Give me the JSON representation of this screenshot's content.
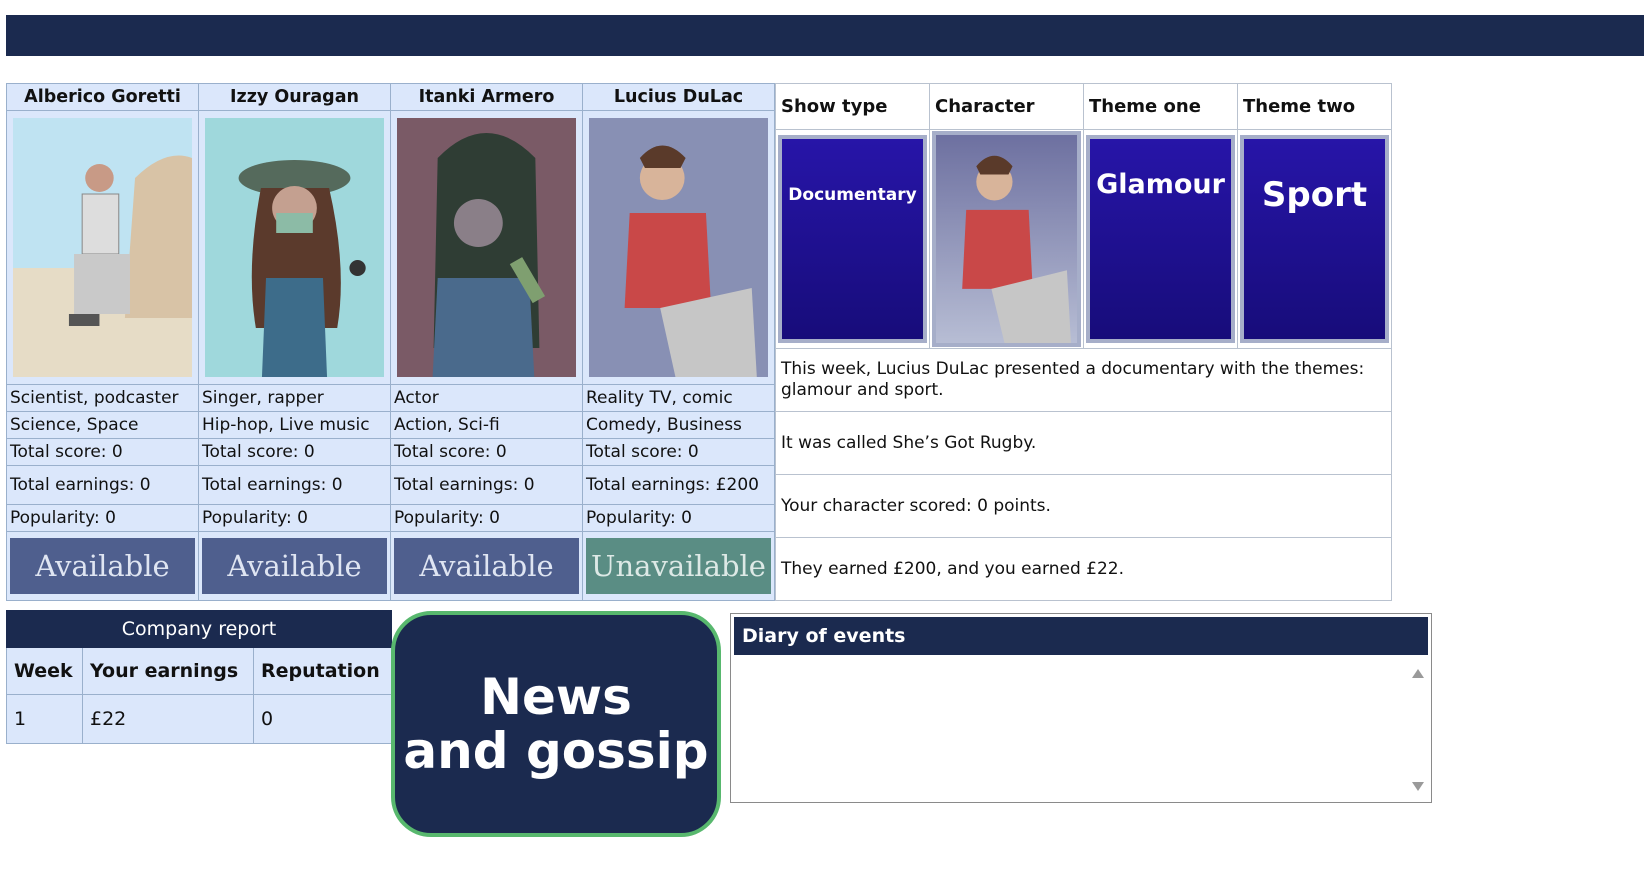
{
  "characters": [
    {
      "name": "Alberico Goretti",
      "profession": "Scientist, podcaster",
      "interests": "Science, Space",
      "total_score": "Total score: 0",
      "total_earnings": "Total earnings: 0",
      "popularity": "Popularity: 0",
      "status": "Available"
    },
    {
      "name": "Izzy Ouragan",
      "profession": "Singer, rapper",
      "interests": "Hip-hop, Live music",
      "total_score": "Total score: 0",
      "total_earnings": "Total earnings: 0",
      "popularity": "Popularity: 0",
      "status": "Available"
    },
    {
      "name": "Itanki Armero",
      "profession": "Actor",
      "interests": "Action, Sci-fi",
      "total_score": "Total score: 0",
      "total_earnings": "Total earnings: 0",
      "popularity": "Popularity: 0",
      "status": "Available"
    },
    {
      "name": "Lucius DuLac",
      "profession": "Reality TV, comic",
      "interests": "Comedy, Business",
      "total_score": "Total score: 0",
      "total_earnings": "Total earnings: £200",
      "popularity": "Popularity: 0",
      "status": "Unavailable"
    }
  ],
  "show": {
    "headers": [
      "Show type",
      "Character",
      "Theme one",
      "Theme two"
    ],
    "cards": {
      "show_type": "Documentary",
      "theme_one": "Glamour",
      "theme_two": "Sport"
    },
    "messages": [
      "This week, Lucius DuLac presented a documentary with the themes: glamour and sport.",
      "It was called She’s Got Rugby.",
      "Your character scored: 0 points.",
      "They earned £200, and you earned £22."
    ]
  },
  "report": {
    "title": "Company report",
    "headers": [
      "Week",
      "Your earnings",
      "Reputation"
    ],
    "rows": [
      [
        "1",
        "£22",
        "0"
      ]
    ]
  },
  "news": {
    "line1": "News",
    "line2": "and gossip"
  },
  "diary": {
    "title": "Diary of events"
  },
  "colors": {
    "navy": "#1b2a4f",
    "cell": "#dbe7fb",
    "available": "#4f5f8e",
    "unavailable": "#5a8d84",
    "card": "#1e1790",
    "news_border": "#58b86e"
  }
}
